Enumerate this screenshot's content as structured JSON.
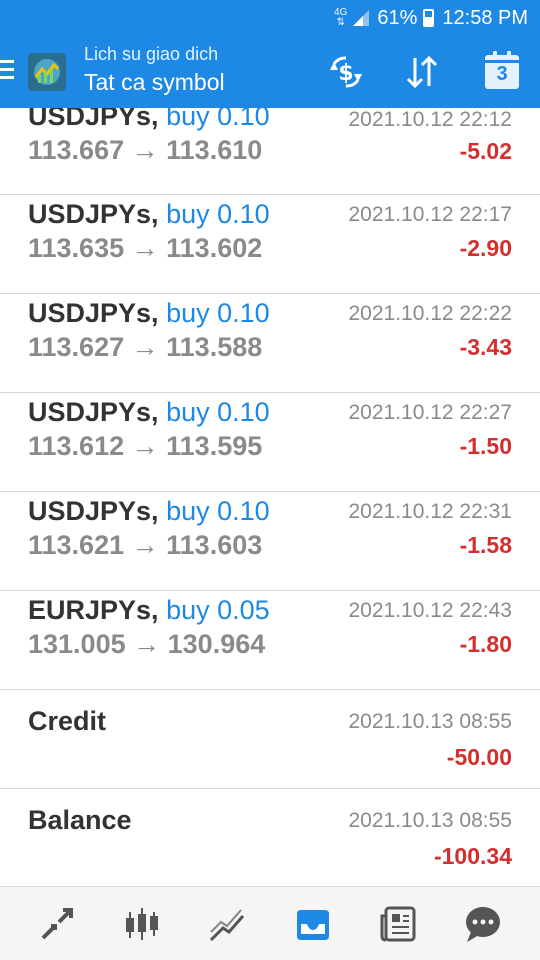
{
  "status_bar": {
    "network": "4G",
    "battery": "61%",
    "time": "12:58 PM"
  },
  "header": {
    "subtitle": "Lich su giao dich",
    "title": "Tat ca symbol",
    "calendar_day": "3"
  },
  "trades": [
    {
      "symbol": "USDJPYs,",
      "direction": "buy 0.10",
      "open": "113.667",
      "close": "113.610",
      "time": "2021.10.12 22:12",
      "profit": "-5.02"
    },
    {
      "symbol": "USDJPYs,",
      "direction": "buy 0.10",
      "open": "113.635",
      "close": "113.602",
      "time": "2021.10.12 22:17",
      "profit": "-2.90"
    },
    {
      "symbol": "USDJPYs,",
      "direction": "buy 0.10",
      "open": "113.627",
      "close": "113.588",
      "time": "2021.10.12 22:22",
      "profit": "-3.43"
    },
    {
      "symbol": "USDJPYs,",
      "direction": "buy 0.10",
      "open": "113.612",
      "close": "113.595",
      "time": "2021.10.12 22:27",
      "profit": "-1.50"
    },
    {
      "symbol": "USDJPYs,",
      "direction": "buy 0.10",
      "open": "113.621",
      "close": "113.603",
      "time": "2021.10.12 22:31",
      "profit": "-1.58"
    },
    {
      "symbol": "EURJPYs,",
      "direction": "buy 0.05",
      "open": "131.005",
      "close": "130.964",
      "time": "2021.10.12 22:43",
      "profit": "-1.80"
    }
  ],
  "operations": [
    {
      "label": "Credit",
      "time": "2021.10.13 08:55",
      "amount": "-50.00"
    },
    {
      "label": "Balance",
      "time": "2021.10.13 08:55",
      "amount": "-100.34"
    }
  ],
  "arrow": "→",
  "colors": {
    "accent": "#1e88e5",
    "loss": "#d32f2f",
    "muted": "#8a8a8a",
    "active_nav": "#1e88e5"
  },
  "nav": [
    "trade-icon",
    "chart-icon",
    "quotes-icon",
    "history-icon",
    "news-icon",
    "chat-icon"
  ]
}
